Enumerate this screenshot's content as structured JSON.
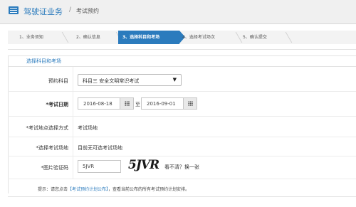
{
  "header": {
    "title": "驾驶证业务",
    "separator": "/",
    "subtitle": "考试预约"
  },
  "steps": [
    {
      "label": "1、业务须知",
      "active": false
    },
    {
      "label": "2、确认信息",
      "active": false
    },
    {
      "label": "3、选择科目和考场",
      "active": true
    },
    {
      "label": "4、选择考试场次",
      "active": false
    },
    {
      "label": "5、确认提交",
      "active": false
    }
  ],
  "form": {
    "section_title": "选择科目和考场",
    "subject": {
      "label": "预约科目",
      "value": "科目三 安全文明常识考试"
    },
    "exam_date": {
      "label": "*考试日期",
      "start": "2016-08-18",
      "end": "2016-09-01",
      "separator": "至"
    },
    "site_mode": {
      "label": "*考试地点选择方式",
      "value": "考试场地"
    },
    "site": {
      "label": "*选择考试场地",
      "value": "目前无可选考试场地"
    },
    "captcha": {
      "label": "*图片验证码",
      "input_value": "5JVR",
      "image_text": "5JVR",
      "refresh_label": "看不清？换一张"
    }
  },
  "hint": {
    "prefix": "提示：请您点击",
    "link": "【考试预约计划公布】",
    "suffix": "，查看当前公布的所有考试预约计划安排。"
  },
  "colors": {
    "accent": "#2b7bbd"
  }
}
